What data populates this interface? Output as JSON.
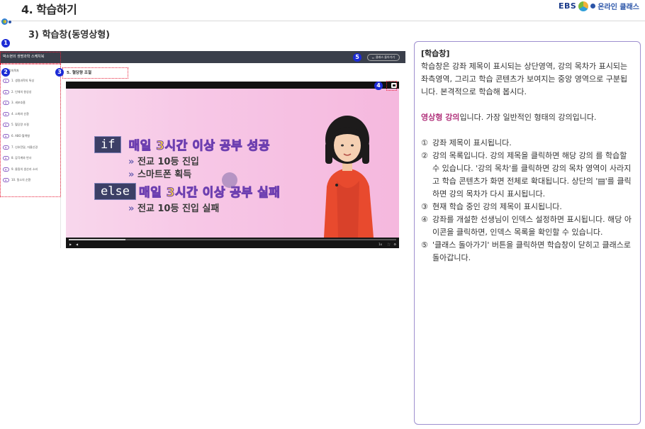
{
  "header": {
    "title": "4. 학습하기",
    "logo_ebs": "EBS",
    "logo_online": "온라인 클래스",
    "subtitle": "3) 학습창(동영상형)"
  },
  "badges": [
    "1",
    "2",
    "3",
    "4",
    "5"
  ],
  "screen": {
    "app_title": "박소현의 생명과학 스케치북",
    "back_button": "클래스 돌아가기",
    "sidebar_head": "강의목차",
    "sidebar_items": [
      "1. 생명과학의 특성",
      "2. 인체의 항상성",
      "3. 세포호흡",
      "4. 소화와 순환",
      "5. 혈당량 조절",
      "6. ABO 혈액형",
      "7. 신호전달, 자율신경",
      "8. 감각계와 반사",
      "9. 물질의 생산과 소비",
      "10. 질소의 순환"
    ],
    "lecture_title": "5. 혈당량 조절",
    "video": {
      "line1_kw": "if",
      "line1_text": "매일 3시간 이상 공부 성공",
      "line2": "전교 10등 진입",
      "line3": "스마트폰 획득",
      "line4_kw": "else",
      "line4_text": "매일 3시간 이상 공부 실패",
      "line5": "전교 10등 진입 실패",
      "arrow": "»",
      "speed": "1x"
    }
  },
  "panel": {
    "heading": "[학습창]",
    "intro": "학습창은 강좌 제목이 표시되는 상단영역, 강의 목차가 표시되는 좌측영역, 그리고 학습 콘텐츠가 보여지는 중앙 영역으로 구분됩니다. 본격적으로 학습해 봅시다.",
    "type_accent": "영상형 강의",
    "type_rest": "입니다. 가장 일반적인 형태의 강의입니다.",
    "items": [
      {
        "n": "①",
        "t": "강좌 제목이 표시됩니다."
      },
      {
        "n": "②",
        "t": "강의 목록입니다. 강의 제목을 클릭하면 해당 강의 를 학습할 수 있습니다. '강의 목차'를 클릭하면 강의 목차 영역이 사라지고 학습 콘텐츠가 화면 전체로 확대됩니다. 상단의 '▤'를 클릭하면 강의 목차가 다시 표시됩니다."
      },
      {
        "n": "③",
        "t": "현재 학습 중인 강의 제목이 표시됩니다."
      },
      {
        "n": "④",
        "t": "강좌를 개설한 선생님이 인덱스 설정하면 표시됩니다. 해당 아이콘을 클릭하면, 인덱스 목록을 확인할 수 있습니다."
      },
      {
        "n": "⑤",
        "t": "'클래스 돌아가기' 버튼을 클릭하면 학습창이 닫히고 클래스로 돌아갑니다."
      }
    ]
  }
}
